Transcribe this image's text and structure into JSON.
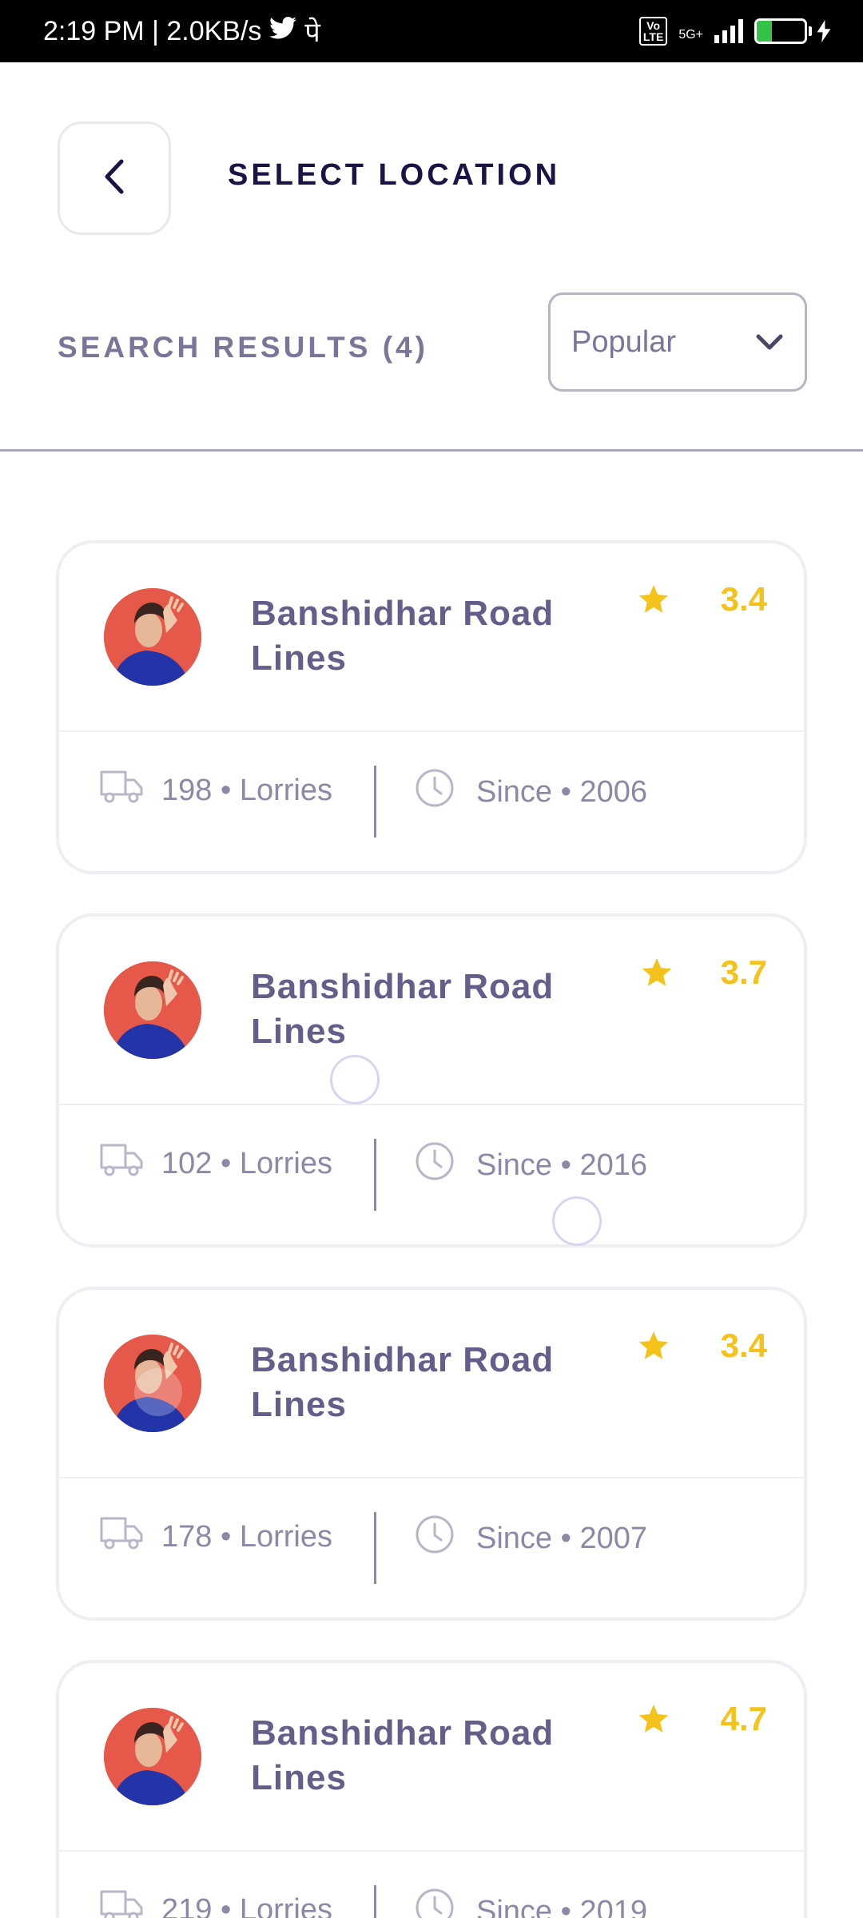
{
  "status_bar": {
    "time_speed": "2:19 PM | 2.0KB/s",
    "extra": "पे",
    "volte": "Vo\nLTE",
    "network": "5G+",
    "battery": "31",
    "battery_level_pct": 31
  },
  "header": {
    "title": "SELECT LOCATION"
  },
  "results": {
    "title": "SEARCH RESULTS (4)",
    "sort_selected": "Popular"
  },
  "cards": [
    {
      "name": "Banshidhar Road Lines",
      "rating": "3.4",
      "lorries": "198 • Lorries",
      "since": "Since • 2006"
    },
    {
      "name": "Banshidhar Road Lines",
      "rating": "3.7",
      "lorries": "102 • Lorries",
      "since": "Since • 2016"
    },
    {
      "name": "Banshidhar Road Lines",
      "rating": "3.4",
      "lorries": "178 • Lorries",
      "since": "Since • 2007"
    },
    {
      "name": "Banshidhar Road Lines",
      "rating": "4.7",
      "lorries": "219 • Lorries",
      "since": "Since • 2019"
    }
  ],
  "colors": {
    "title": "#1a1446",
    "muted": "#7b7599",
    "card_name": "#655e8a",
    "rating": "#f5c21b",
    "avatar_bg": "#e6584a"
  }
}
